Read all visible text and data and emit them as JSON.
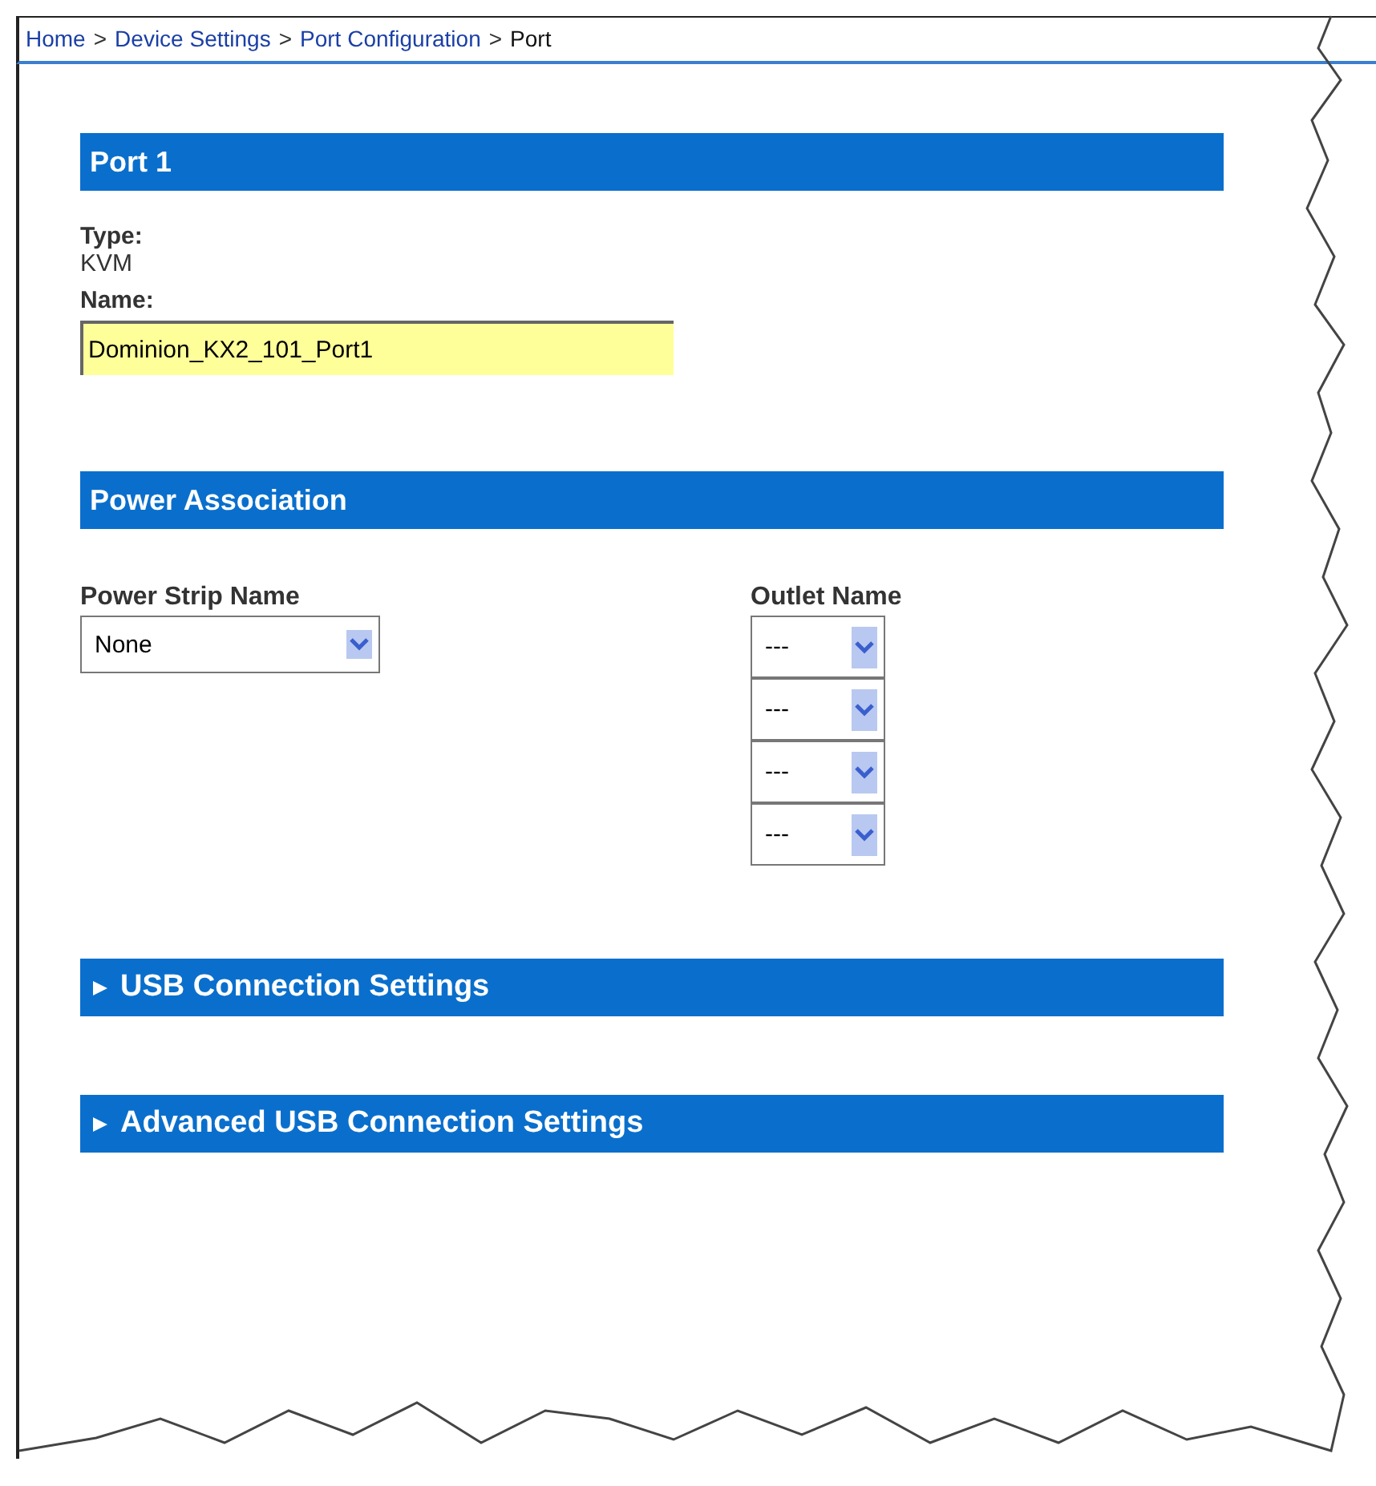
{
  "breadcrumb": [
    {
      "label": "Home",
      "kind": "link"
    },
    {
      "label": "Device Settings",
      "kind": "link"
    },
    {
      "label": "Port Configuration",
      "kind": "link"
    },
    {
      "label": "Port",
      "kind": "current"
    }
  ],
  "breadcrumb_separator": ">",
  "port_section": {
    "title": "Port 1",
    "type_label": "Type:",
    "type_value": "KVM",
    "name_label": "Name:",
    "name_value": "Dominion_KX2_101_Port1"
  },
  "power_section": {
    "title": "Power Association",
    "strip_label": "Power Strip Name",
    "strip_value": "None",
    "outlet_label": "Outlet Name",
    "outlets": [
      "---",
      "---",
      "---",
      "---"
    ]
  },
  "collapsible_sections": [
    {
      "title": "USB Connection Settings",
      "expanded": false
    },
    {
      "title": "Advanced USB Connection Settings",
      "expanded": false
    }
  ]
}
